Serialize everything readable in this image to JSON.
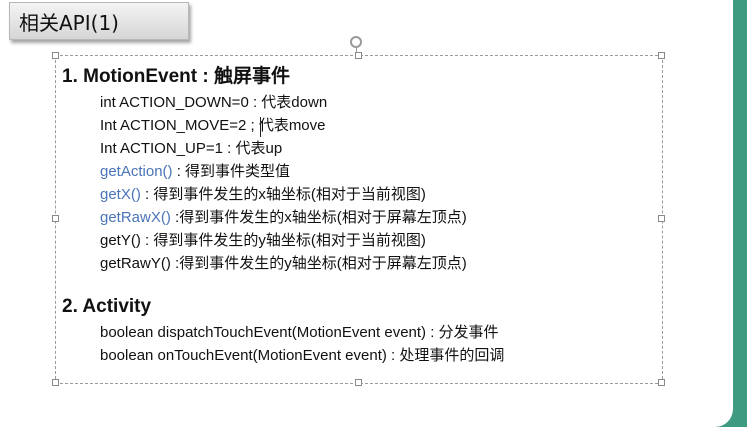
{
  "slide": {
    "title": "相关API(1)"
  },
  "sections": [
    {
      "heading": "1. MotionEvent : 触屏事件",
      "items": [
        {
          "code": "int ACTION_DOWN=0",
          "desc": " : 代表down"
        },
        {
          "code": "Int ACTION_MOVE=2",
          "desc": " ; 代表move"
        },
        {
          "code": "Int ACTION_UP=1",
          "desc": " : 代表up"
        },
        {
          "code": "getAction()",
          "desc": " :  得到事件类型值"
        },
        {
          "code": "getX()",
          "desc": " : 得到事件发生的x轴坐标(相对于当前视图)"
        },
        {
          "code": "getRawX()",
          "desc": " :得到事件发生的x轴坐标(相对于屏幕左顶点)"
        },
        {
          "code": "getY()",
          "desc": " : 得到事件发生的y轴坐标(相对于当前视图)"
        },
        {
          "code": "getRawY()",
          "desc": " :得到事件发生的y轴坐标(相对于屏幕左顶点)"
        }
      ]
    },
    {
      "heading": "2. Activity",
      "items": [
        {
          "code": "boolean dispatchTouchEvent(MotionEvent event)",
          "desc": " : 分发事件"
        },
        {
          "code": "boolean onTouchEvent(MotionEvent event)",
          "desc": " : 处理事件的回调"
        }
      ]
    }
  ],
  "colors": {
    "background_teal": "#3f9a82",
    "method_blue": "#4a74b8",
    "text": "#111111"
  }
}
